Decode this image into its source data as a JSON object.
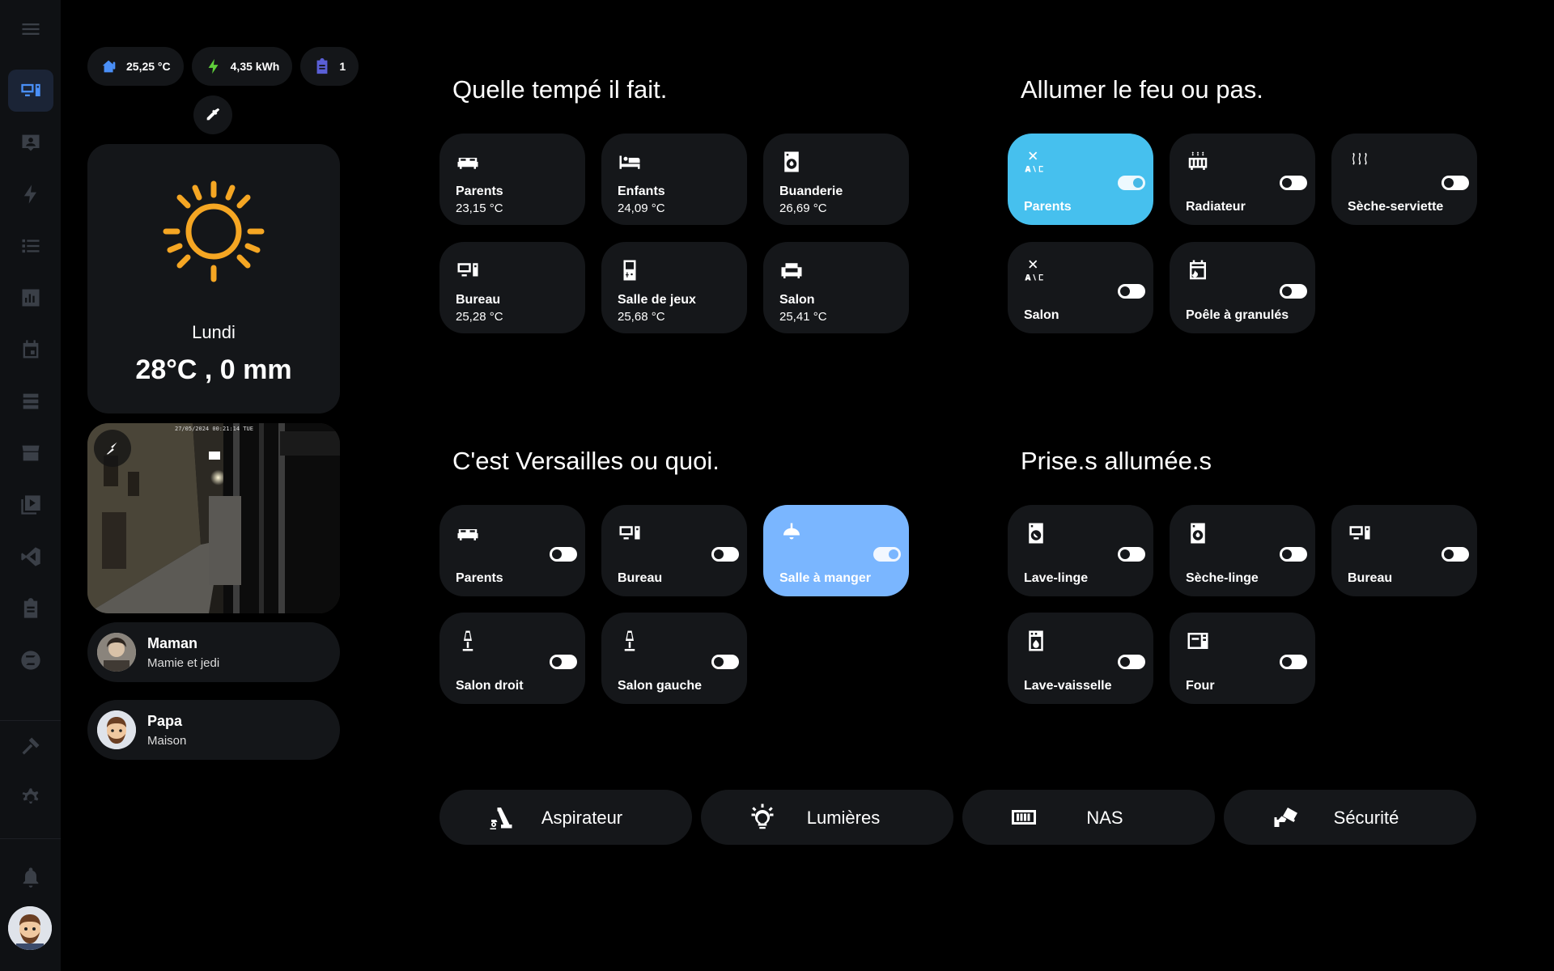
{
  "sidebar": {
    "items": [
      "menu-icon",
      "overview-icon",
      "person-icon",
      "energy-icon",
      "list-icon",
      "history-icon",
      "calendar-icon",
      "server-icon",
      "hacs-icon",
      "media-icon",
      "vscode-icon",
      "clipboard-icon",
      "zigbee-icon",
      "hammer-icon",
      "settings-icon",
      "bell-icon"
    ]
  },
  "chips": {
    "temperature": "25,25 °C",
    "energy": "4,35 kWh",
    "tasks": "1"
  },
  "weather": {
    "day": "Lundi",
    "value": "28°C , 0 mm"
  },
  "camera": {
    "timestamp": "27/05/2024 00:21:14 TUE"
  },
  "persons": [
    {
      "name": "Maman",
      "state": "Mamie et jedi"
    },
    {
      "name": "Papa",
      "state": "Maison"
    }
  ],
  "sections": {
    "temperature": {
      "title": "Quelle tempé il fait.",
      "tiles": [
        {
          "name": "Parents",
          "value": "23,15 °C",
          "icon": "bed-icon"
        },
        {
          "name": "Enfants",
          "value": "24,09 °C",
          "icon": "bed-single-icon"
        },
        {
          "name": "Buanderie",
          "value": "26,69 °C",
          "icon": "washer-icon"
        },
        {
          "name": "Bureau",
          "value": "25,28 °C",
          "icon": "desktop-icon"
        },
        {
          "name": "Salle de jeux",
          "value": "25,68 °C",
          "icon": "gameboy-icon"
        },
        {
          "name": "Salon",
          "value": "25,41 °C",
          "icon": "sofa-icon"
        }
      ]
    },
    "heating": {
      "title": "Allumer le feu ou pas.",
      "tiles": [
        {
          "name": "Parents",
          "icon": "air-conditioner-icon",
          "on": true
        },
        {
          "name": "Radiateur",
          "icon": "radiator-icon",
          "on": false
        },
        {
          "name": "Sèche-serviette",
          "icon": "heat-wave-icon",
          "on": false
        },
        {
          "name": "Salon",
          "icon": "air-conditioner-icon",
          "on": false
        },
        {
          "name": "Poêle à granulés",
          "icon": "stove-icon",
          "on": false
        }
      ]
    },
    "lights": {
      "title": "C'est Versailles ou quoi.",
      "tiles": [
        {
          "name": "Parents",
          "icon": "bed-icon",
          "on": false
        },
        {
          "name": "Bureau",
          "icon": "desktop-icon",
          "on": false
        },
        {
          "name": "Salle à manger",
          "icon": "ceiling-light-icon",
          "on": true
        },
        {
          "name": "Salon droit",
          "icon": "floor-lamp-icon",
          "on": false
        },
        {
          "name": "Salon gauche",
          "icon": "floor-lamp-icon",
          "on": false
        }
      ]
    },
    "plugs": {
      "title": "Prise.s allumée.s",
      "tiles": [
        {
          "name": "Lave-linge",
          "icon": "washing-machine-icon",
          "on": false
        },
        {
          "name": "Sèche-linge",
          "icon": "tumble-dryer-icon",
          "on": false
        },
        {
          "name": "Bureau",
          "icon": "desktop-icon",
          "on": false
        },
        {
          "name": "Lave-vaisselle",
          "icon": "dishwasher-icon",
          "on": false
        },
        {
          "name": "Four",
          "icon": "oven-icon",
          "on": false
        }
      ]
    }
  },
  "bottom_buttons": [
    {
      "label": "Aspirateur",
      "icon": "robot-vacuum-icon"
    },
    {
      "label": "Lumières",
      "icon": "lightbulb-icon"
    },
    {
      "label": "NAS",
      "icon": "nas-icon"
    },
    {
      "label": "Sécurité",
      "icon": "cctv-icon"
    }
  ],
  "colors": {
    "accent_blue": "#46c0ee",
    "accent_light_blue": "#7ab6ff",
    "sidebar_active": "#4a8ff7",
    "sun_orange": "#f5a623",
    "card_bg": "#15171a"
  }
}
